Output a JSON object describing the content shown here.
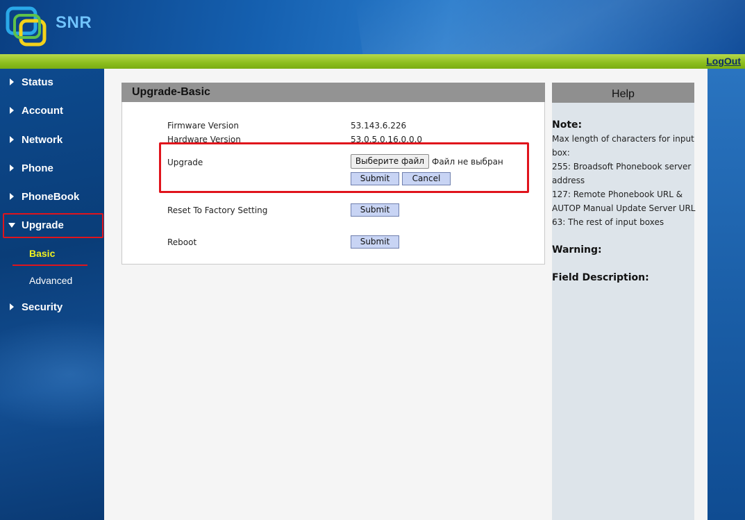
{
  "header": {
    "logo_text": "SNR",
    "logout_label": "LogOut"
  },
  "sidebar": {
    "items": [
      {
        "label": "Status"
      },
      {
        "label": "Account"
      },
      {
        "label": "Network"
      },
      {
        "label": "Phone"
      },
      {
        "label": "PhoneBook"
      },
      {
        "label": "Upgrade"
      },
      {
        "label": "Security"
      }
    ],
    "sub_items": [
      {
        "label": "Basic"
      },
      {
        "label": "Advanced"
      }
    ]
  },
  "main": {
    "title": "Upgrade-Basic",
    "rows": {
      "firmware_label": "Firmware Version",
      "firmware_value": "53.143.6.226",
      "hardware_label": "Hardware Version",
      "hardware_value": "53.0.5.0.16.0.0.0",
      "upgrade_label": "Upgrade",
      "file_button": "Выберите файл",
      "file_status": "Файл не выбран",
      "submit_label": "Submit",
      "cancel_label": "Cancel",
      "reset_label": "Reset To Factory Setting",
      "reboot_label": "Reboot"
    }
  },
  "help": {
    "title": "Help",
    "note_head": "Note:",
    "note_lines": [
      "Max length of characters for input",
      "box:",
      "255: Broadsoft Phonebook server",
      "address",
      "127: Remote Phonebook URL &",
      "AUTOP Manual Update Server URL",
      "63: The rest of input boxes"
    ],
    "warning_head": "Warning:",
    "field_head": "Field Description:"
  },
  "colors": {
    "accent_red": "#e0141c",
    "active_sub": "#f2f21e",
    "green_bar": "#8cbe1e"
  }
}
